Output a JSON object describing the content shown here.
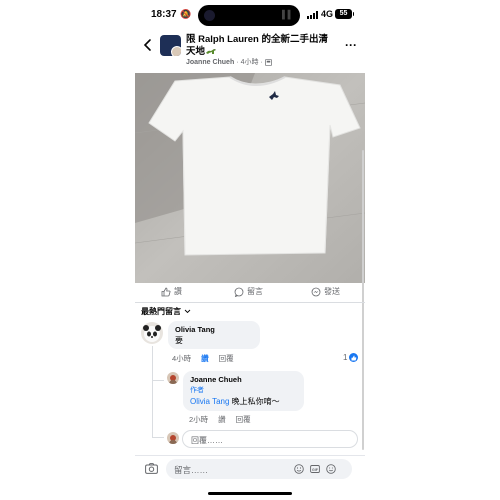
{
  "status_bar": {
    "time": "18:37",
    "network": "4G",
    "battery": "55"
  },
  "header": {
    "group_title": "限 Ralph Lauren 的全新二手出清天地",
    "author": "Joanne Chueh",
    "time": "4小時",
    "separator": "·"
  },
  "actions": {
    "like": "讚",
    "comment": "留言",
    "share": "發送"
  },
  "comments": {
    "sort_label": "最熱門留言",
    "items": [
      {
        "name": "Olivia Tang",
        "text": "要",
        "time": "4小時",
        "like_label": "讚",
        "reply_label": "回覆",
        "reaction_count": "1"
      }
    ],
    "reply": {
      "name": "Joanne Chueh",
      "badge": "作者",
      "mention": "Olivia Tang",
      "text": " 晚上私你唷～",
      "time": "2小時",
      "like_label": "讚",
      "reply_label": "回覆"
    },
    "reply_placeholder": "回覆……"
  },
  "composer": {
    "placeholder": "留言……",
    "icons": [
      "camera-icon",
      "sticker-icon",
      "gif-icon",
      "emoji-icon"
    ]
  },
  "colors": {
    "accent": "#1877f2",
    "secondary_text": "#65676b",
    "bubble": "#f0f2f5"
  }
}
